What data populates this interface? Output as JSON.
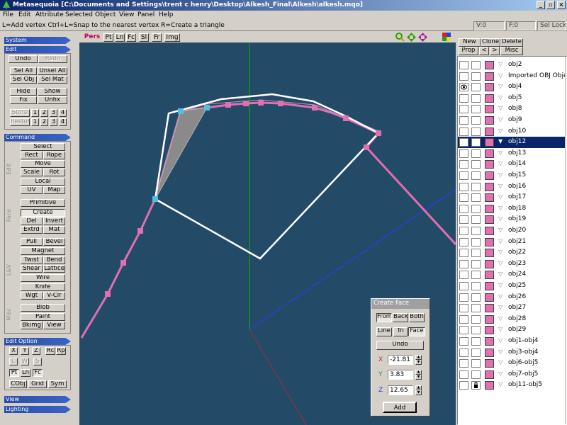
{
  "window": {
    "title": "Metasequoia [C:\\Documents and Settings\\trent c henry\\Desktop\\Alkesh_Final\\Alkesh\\alkesh.mqo]",
    "minimize": "_",
    "maximize": "▫",
    "close": "×"
  },
  "menu": [
    "File",
    "Edit",
    "Attribute",
    "Selected",
    "Object",
    "View",
    "Panel",
    "Help"
  ],
  "status": {
    "hint": "L=Add vertex  Ctrl+L=Snap to the nearest vertex  R=Create a triangle",
    "vertex_count": "V:0",
    "face_count": "F:0",
    "sel_lock": "Sel Lock"
  },
  "left": {
    "system": "System",
    "edit": "Edit",
    "undo": "Undo",
    "redo": "Redo",
    "sel_all": "Sel All",
    "unsel_all": "Unsel All",
    "sel_obj": "Sel Obj",
    "sel_mat": "Sel Mat",
    "hide": "Hide",
    "show": "Show",
    "fix": "Fix",
    "unfix": "Unfix",
    "store": "Store",
    "restore": "Restore",
    "slots": [
      "1",
      "2",
      "3",
      "4"
    ],
    "command": "Command",
    "cmd_edit_label": "Edit",
    "select": "Select",
    "rect": "Rect",
    "rope": "Rope",
    "move": "Move",
    "scale": "Scale",
    "rot": "Rot",
    "local": "Local",
    "uv": "UV",
    "map": "Map",
    "face_label": "Face",
    "primitive": "Primitive",
    "create": "Create",
    "del": "Del",
    "invert": "Invert",
    "extrd": "Extrd",
    "mat": "Mat",
    "lsv_label": "L&V",
    "pull": "Pull",
    "bevel": "Bevel",
    "magnet": "Magnet",
    "twist": "Twist",
    "bend": "Bend",
    "shear": "Shear",
    "lattice": "Lattice",
    "wire": "Wire",
    "knife": "Knife",
    "wgt": "Wgt",
    "vclr": "V-Clr",
    "misc_label": "Misc",
    "blob": "Blob",
    "paint": "Paint",
    "bkimg": "Bkimg",
    "view_btn": "View",
    "edit_option": "Edit Option",
    "x": "X",
    "y": "Y",
    "z": "Z",
    "rc": "Rc",
    "rp": "Rp",
    "l": "L",
    "w": "W",
    "s": "S",
    "pt": "Pt",
    "ln": "Ln",
    "fc": "Fc",
    "cobj": "CObj",
    "grid": "Grid",
    "sym": "Sym",
    "view_sec": "View",
    "lighting": "Lighting"
  },
  "viewport": {
    "tabs": [
      "Pers",
      "Pt",
      "Ln",
      "Fc",
      "Sl",
      "Fr",
      "Img"
    ],
    "active_tab": "Pers",
    "icons": [
      "zoom-icon",
      "move-view-icon",
      "rotate-view-icon",
      "color-palette-icon"
    ],
    "colors": {
      "background": "#234a67",
      "selected_line": "#ffffff",
      "vertex": "#e070b0",
      "selected_vertex": "#50c0e0",
      "axis_green": "#00c000",
      "axis_blue": "#2040ff",
      "axis_red": "#a03030"
    }
  },
  "create_face": {
    "title": "Create Face",
    "from": "From",
    "back": "Back",
    "both": "Both",
    "line": "Line",
    "tri": "Tri",
    "face": "Face",
    "undo": "Undo",
    "x_label": "X",
    "y_label": "Y",
    "z_label": "Z",
    "x_value": "-21.81",
    "y_value": "3.83",
    "z_value": "12.65",
    "add": "Add"
  },
  "right": {
    "new": "New",
    "clone": "Clone",
    "delete": "Delete",
    "prop": "Prop",
    "prev": "<",
    "next": ">",
    "misc": "Misc",
    "objects": [
      {
        "name": "obj2",
        "visible": false,
        "locked": false,
        "selected": false
      },
      {
        "name": "Imported OBJ Object",
        "visible": false,
        "locked": false,
        "selected": false
      },
      {
        "name": "obj4",
        "visible": true,
        "locked": false,
        "selected": false
      },
      {
        "name": "obj5",
        "visible": false,
        "locked": false,
        "selected": false
      },
      {
        "name": "obj8",
        "visible": false,
        "locked": false,
        "selected": false
      },
      {
        "name": "obj9",
        "visible": false,
        "locked": false,
        "selected": false
      },
      {
        "name": "obj10",
        "visible": false,
        "locked": false,
        "selected": false
      },
      {
        "name": "obj12",
        "visible": false,
        "locked": false,
        "selected": true
      },
      {
        "name": "obj13",
        "visible": false,
        "locked": false,
        "selected": false
      },
      {
        "name": "obj14",
        "visible": false,
        "locked": false,
        "selected": false
      },
      {
        "name": "obj15",
        "visible": false,
        "locked": false,
        "selected": false
      },
      {
        "name": "obj16",
        "visible": false,
        "locked": false,
        "selected": false
      },
      {
        "name": "obj17",
        "visible": false,
        "locked": false,
        "selected": false
      },
      {
        "name": "obj18",
        "visible": false,
        "locked": false,
        "selected": false
      },
      {
        "name": "obj19",
        "visible": false,
        "locked": false,
        "selected": false
      },
      {
        "name": "obj20",
        "visible": false,
        "locked": false,
        "selected": false
      },
      {
        "name": "obj21",
        "visible": false,
        "locked": false,
        "selected": false
      },
      {
        "name": "obj22",
        "visible": false,
        "locked": false,
        "selected": false
      },
      {
        "name": "obj23",
        "visible": false,
        "locked": false,
        "selected": false
      },
      {
        "name": "obj24",
        "visible": false,
        "locked": false,
        "selected": false
      },
      {
        "name": "obj25",
        "visible": false,
        "locked": false,
        "selected": false
      },
      {
        "name": "obj26",
        "visible": false,
        "locked": false,
        "selected": false
      },
      {
        "name": "obj27",
        "visible": false,
        "locked": false,
        "selected": false
      },
      {
        "name": "obj28",
        "visible": false,
        "locked": false,
        "selected": false
      },
      {
        "name": "obj29",
        "visible": false,
        "locked": false,
        "selected": false
      },
      {
        "name": "obj1-obj4",
        "visible": false,
        "locked": false,
        "selected": false
      },
      {
        "name": "obj3-obj4",
        "visible": false,
        "locked": false,
        "selected": false
      },
      {
        "name": "obj6-obj5",
        "visible": false,
        "locked": false,
        "selected": false
      },
      {
        "name": "obj7-obj5",
        "visible": false,
        "locked": false,
        "selected": false
      },
      {
        "name": "obj11-obj5",
        "visible": false,
        "locked": true,
        "selected": false
      }
    ]
  }
}
